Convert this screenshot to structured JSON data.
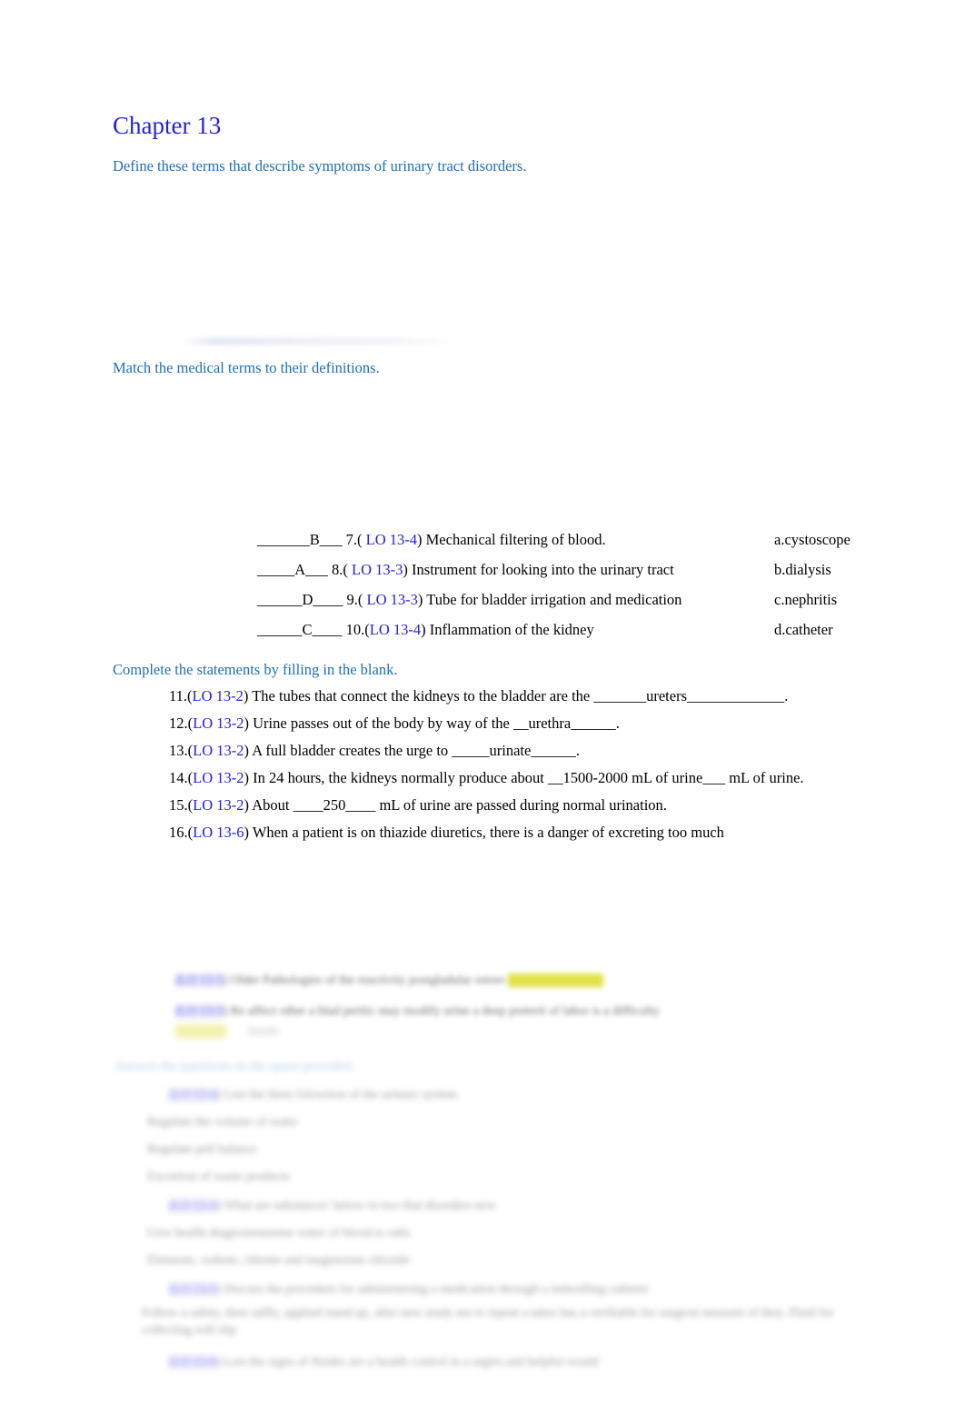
{
  "document": {
    "title": "Chapter 13",
    "headings": {
      "define": "Define these terms that describe symptoms of urinary tract disorders.",
      "match": "Match the medical terms to their definitions.",
      "complete": "Complete the statements by filling in the blank."
    }
  },
  "colors": {
    "title_blue": "#2222DD",
    "heading_blue": "#1F6FB5",
    "lo_blue": "#2222DD",
    "highlight_yellow": "#D9D916",
    "body_black": "#000000"
  },
  "matching": {
    "rows": [
      {
        "blank_pre": "_______",
        "answer_letter": "B",
        "blank_post": "___ ",
        "number": "7.(",
        "lo": "  LO 13-4",
        "text": ") Mechanical filtering of blood.",
        "choice": "a.cystoscope"
      },
      {
        "blank_pre": "_____",
        "answer_letter": "A",
        "blank_post": "___ ",
        "number": "8.(",
        "lo": "  LO 13-3",
        "text": ") Instrument for looking into the urinary tract",
        "choice": "b.dialysis"
      },
      {
        "blank_pre": "______",
        "answer_letter": "D",
        "blank_post": "____ ",
        "number": "9.(",
        "lo": "  LO 13-3",
        "text": ") Tube for bladder irrigation and medication",
        "choice": "c.nephritis"
      },
      {
        "blank_pre": "______",
        "answer_letter": "C",
        "blank_post": "____ ",
        "number": "10.(",
        "lo": "LO 13-4",
        "text": ") Inflammation of the kidney",
        "choice": "d.catheter"
      }
    ]
  },
  "fill_in_blank": {
    "items": [
      {
        "number": "11.(",
        "lo": "LO 13-2",
        "text": ") The tubes that connect the kidneys to the bladder are the _______ureters_____________."
      },
      {
        "number": "12.(",
        "lo": "LO 13-2",
        "text": ") Urine passes out of the body by way of the __urethra______."
      },
      {
        "number": "13.(",
        "lo": "LO 13-2",
        "text": ") A full bladder creates the urge to  _____urinate______."
      },
      {
        "number": "14.(",
        "lo": "LO 13-2",
        "text": ") In 24 hours, the kidneys normally produce about __1500-2000 mL of urine___ mL of urine."
      },
      {
        "number": "15.(",
        "lo": "LO 13-2",
        "text": ") About ____250____ mL of urine are passed during normal urination."
      },
      {
        "number": "16.(",
        "lo": "LO 13-6",
        "text": ") When a patient is on thiazide diuretics, there is a danger of excreting too much"
      }
    ]
  },
  "obscured_region": {
    "note": "Lower portion of the page is blurred/illegible in the screenshot; text is not readable.",
    "placeholder_lines": [
      "illegible blurred line",
      "illegible blurred line"
    ]
  }
}
